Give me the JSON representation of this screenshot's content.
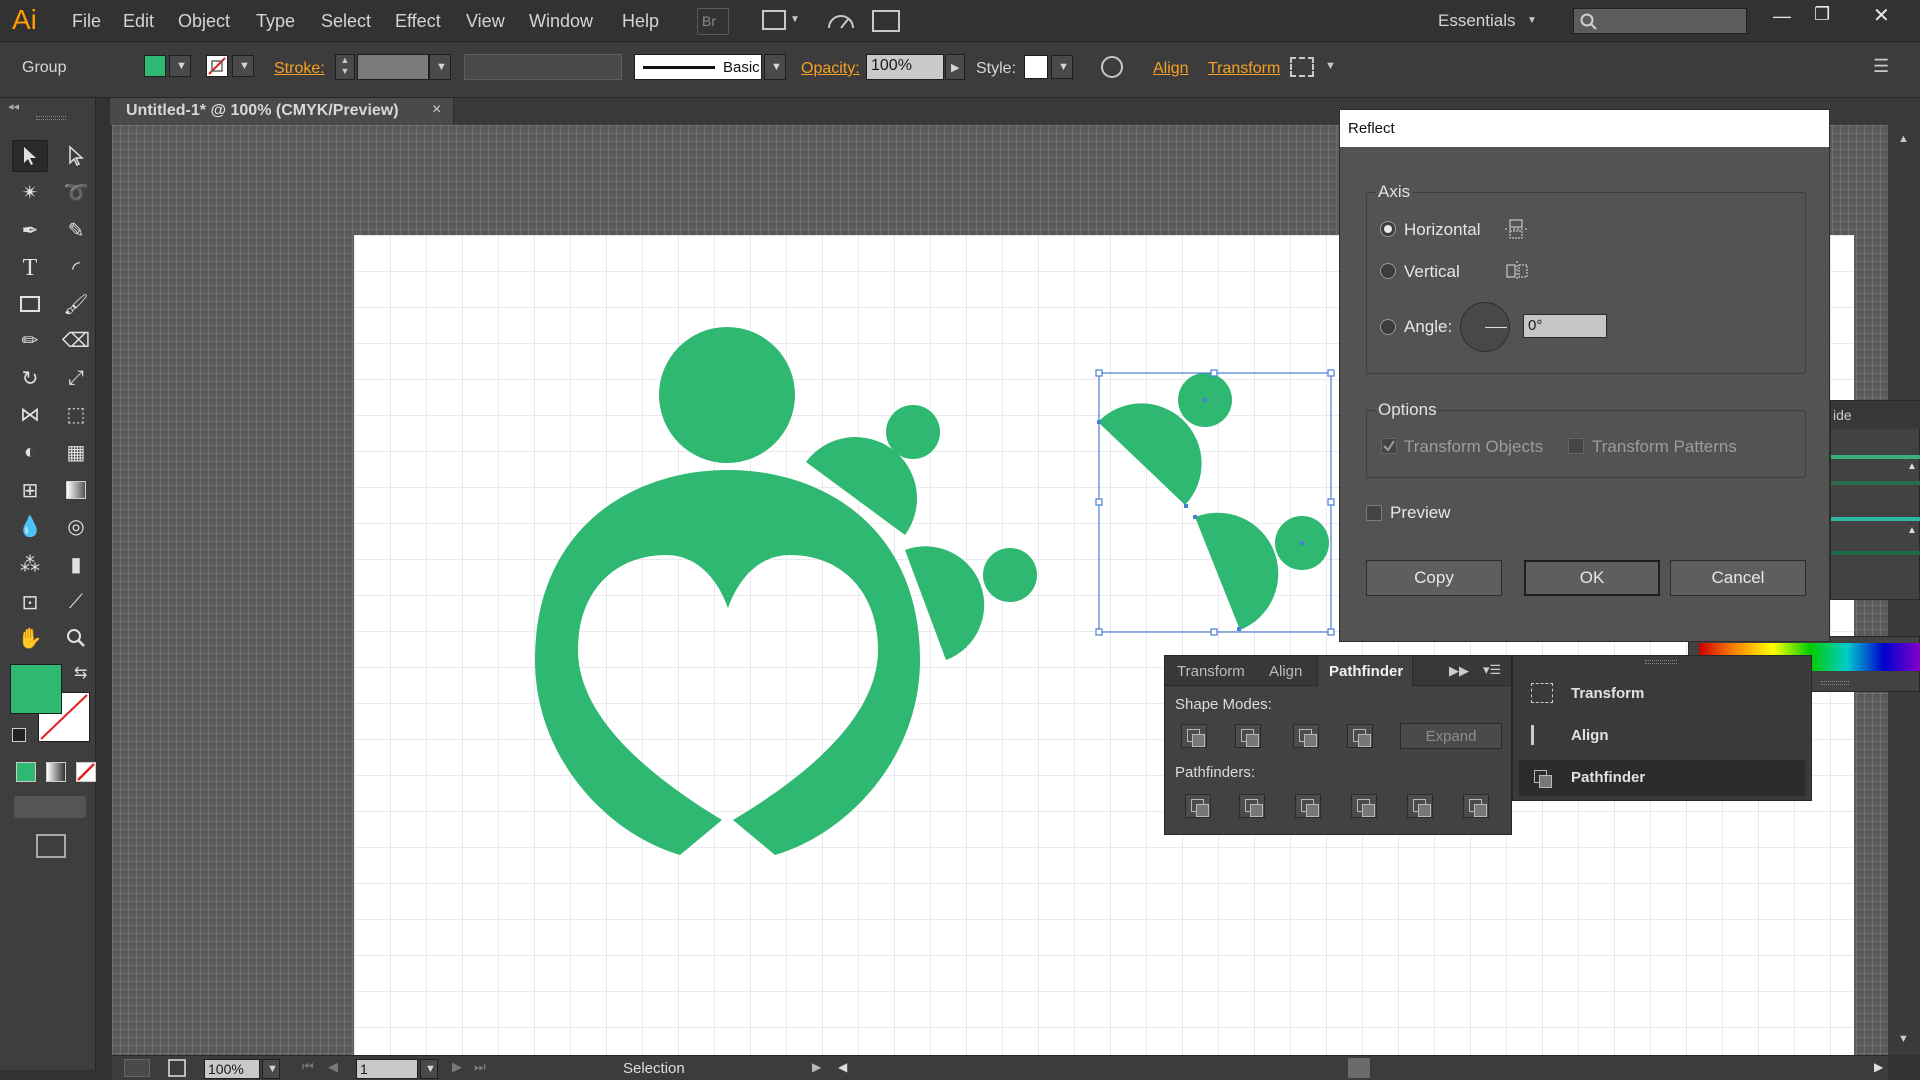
{
  "app": {
    "logo": "Ai",
    "workspace": "Essentials",
    "search_placeholder": ""
  },
  "menu": [
    "File",
    "Edit",
    "Object",
    "Type",
    "Select",
    "Effect",
    "View",
    "Window",
    "Help"
  ],
  "menu_extra": {
    "bridge": "Br"
  },
  "window_controls": {
    "minimize": "—",
    "restore": "❐",
    "close": "✕"
  },
  "control_bar": {
    "selection_type": "Group",
    "fill_color": "#2eb872",
    "stroke_label": "Stroke:",
    "stroke_value": "",
    "profile_value": "",
    "brush_label": "Basic",
    "opacity_label": "Opacity:",
    "opacity_value": "100%",
    "style_label": "Style:",
    "align_link": "Align",
    "transform_link": "Transform"
  },
  "document_tab": {
    "title": "Untitled-1* @ 100% (CMYK/Preview)",
    "close": "×"
  },
  "toolbar": {
    "tools": [
      "selection-tool",
      "direct-selection-tool",
      "magic-wand-tool",
      "lasso-tool",
      "pen-tool",
      "curvature-pen-tool",
      "type-tool",
      "arc-tool",
      "rectangle-tool",
      "paintbrush-tool",
      "pencil-tool",
      "eraser-tool",
      "rotate-tool",
      "scale-tool",
      "width-tool",
      "free-transform-tool",
      "shape-builder-tool",
      "perspective-grid-tool",
      "mesh-tool",
      "gradient-tool",
      "eyedropper-tool",
      "blend-tool",
      "symbol-sprayer-tool",
      "column-graph-tool",
      "artboard-tool",
      "slice-tool",
      "hand-tool",
      "zoom-tool"
    ],
    "fill_color": "#2eb872"
  },
  "status_bar": {
    "zoom": "100%",
    "artboard_number": "1",
    "status_text": "Selection"
  },
  "reflect_dialog": {
    "title": "Reflect",
    "axis_legend": "Axis",
    "horizontal_label": "Horizontal",
    "vertical_label": "Vertical",
    "angle_label": "Angle:",
    "angle_value": "0°",
    "selected_axis": "horizontal",
    "options_legend": "Options",
    "transform_objects_label": "Transform Objects",
    "transform_patterns_label": "Transform Patterns",
    "preview_label": "Preview",
    "copy_button": "Copy",
    "ok_button": "OK",
    "cancel_button": "Cancel"
  },
  "pathfinder_panel": {
    "tabs": [
      "Transform",
      "Align",
      "Pathfinder"
    ],
    "active_tab": "Pathfinder",
    "shape_modes_label": "Shape Modes:",
    "expand_button": "Expand",
    "pathfinders_label": "Pathfinders:"
  },
  "dock_panel": {
    "items": [
      "Transform",
      "Align",
      "Pathfinder"
    ],
    "active": "Pathfinder",
    "partial_tab": "ide"
  },
  "colors": {
    "brand_green": "#2eb872",
    "accent_orange": "#f7a023",
    "selection_blue": "#4a7fd6"
  }
}
